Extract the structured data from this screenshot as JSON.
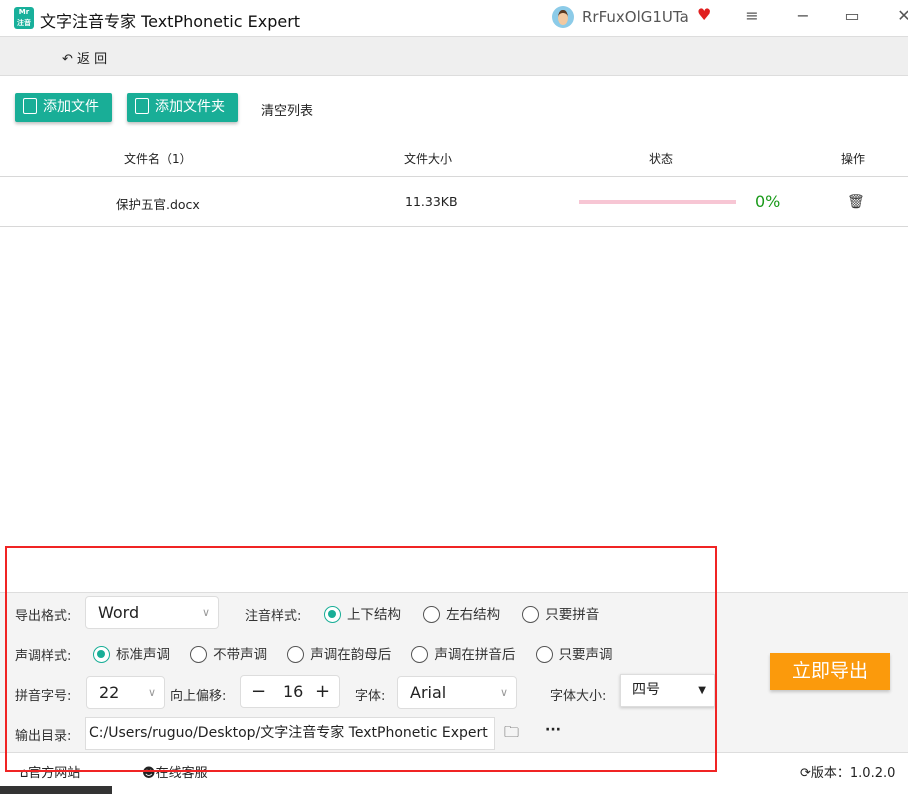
{
  "app": {
    "title": "文字注音专家 TextPhonetic Expert",
    "logo_text": "Mr.n 注音",
    "username": "RrFuxOlG1UTa"
  },
  "nav": {
    "back": "返 回"
  },
  "toolbar": {
    "add_file": "添加文件",
    "add_folder": "添加文件夹",
    "clear_list": "清空列表"
  },
  "table": {
    "headers": [
      "文件名（1）",
      "文件大小",
      "状态",
      "操作"
    ],
    "rows": [
      {
        "name": "保护五官.docx",
        "size": "11.33KB",
        "progress": 0,
        "progress_label": "0%"
      }
    ]
  },
  "settings": {
    "export_format_label": "导出格式:",
    "export_format": "Word",
    "annotation_style_label": "注音样式:",
    "annotation_styles": [
      "上下结构",
      "左右结构",
      "只要拼音"
    ],
    "annotation_selected": 0,
    "tone_style_label": "声调样式:",
    "tone_styles": [
      "标准声调",
      "不带声调",
      "声调在韵母后",
      "声调在拼音后",
      "只要声调"
    ],
    "tone_selected": 0,
    "pinyin_size_label": "拼音字号:",
    "pinyin_size": "22",
    "offset_label": "向上偏移:",
    "offset": "16",
    "minus": "−",
    "plus": "+",
    "font_label": "字体:",
    "font": "Arial",
    "font_size_label": "字体大小:",
    "font_size": "四号",
    "output_dir_label": "输出目录:",
    "output_dir": "C:/Users/ruguo/Desktop/文字注音专家 TextPhonetic Expert",
    "more": "···"
  },
  "export_button": "立即导出",
  "footer": {
    "website": "官方网站",
    "support": "在线客服",
    "version": "版本：1.0.2.0"
  },
  "colors": {
    "accent": "#19ae97",
    "export": "#fb9a0c",
    "highlight": "#f02424"
  }
}
